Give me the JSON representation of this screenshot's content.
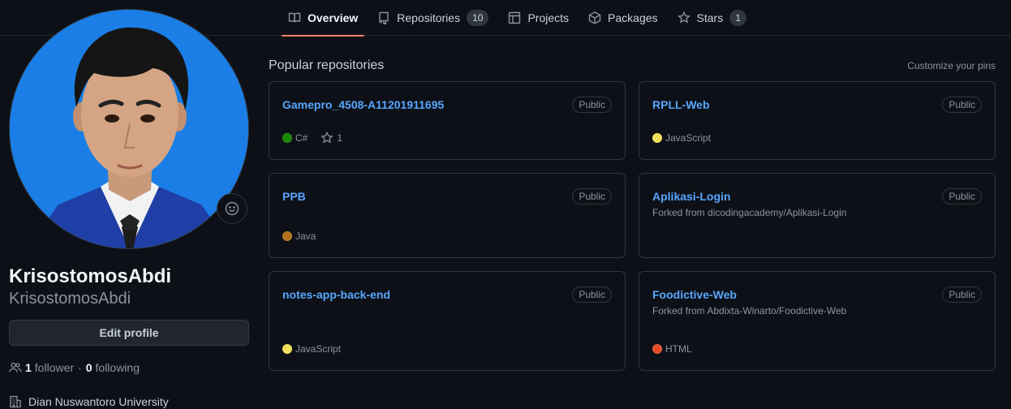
{
  "tabs": [
    {
      "label": "Overview",
      "icon": "book-icon",
      "active": true
    },
    {
      "label": "Repositories",
      "icon": "repo-icon",
      "count": "10"
    },
    {
      "label": "Projects",
      "icon": "table-icon"
    },
    {
      "label": "Packages",
      "icon": "package-icon"
    },
    {
      "label": "Stars",
      "icon": "star-icon",
      "count": "1"
    }
  ],
  "profile": {
    "fullname": "KrisostomosAbdi",
    "username": "KrisostomosAbdi",
    "edit_label": "Edit profile",
    "followers_count": "1",
    "followers_label": "follower",
    "following_count": "0",
    "following_label": "following",
    "separator": "·",
    "organization": "Dian Nuswantoro University"
  },
  "popular": {
    "title": "Popular repositories",
    "customize": "Customize your pins"
  },
  "repos": [
    {
      "name": "Gamepro_4508-A11201911695",
      "visibility": "Public",
      "language": "C#",
      "lang_color": "#178600",
      "stars": "1",
      "forked": ""
    },
    {
      "name": "RPLL-Web",
      "visibility": "Public",
      "language": "JavaScript",
      "lang_color": "#f1e05a",
      "forked": ""
    },
    {
      "name": "PPB",
      "visibility": "Public",
      "language": "Java",
      "lang_color": "#b07219",
      "forked": ""
    },
    {
      "name": "Aplikasi-Login",
      "visibility": "Public",
      "language": "",
      "forked": "Forked from dicodingacademy/Aplikasi-Login"
    },
    {
      "name": "notes-app-back-end",
      "visibility": "Public",
      "language": "JavaScript",
      "lang_color": "#f1e05a",
      "forked": ""
    },
    {
      "name": "Foodictive-Web",
      "visibility": "Public",
      "language": "HTML",
      "lang_color": "#e34c26",
      "forked": "Forked from Abdixta-Winarto/Foodictive-Web"
    }
  ]
}
